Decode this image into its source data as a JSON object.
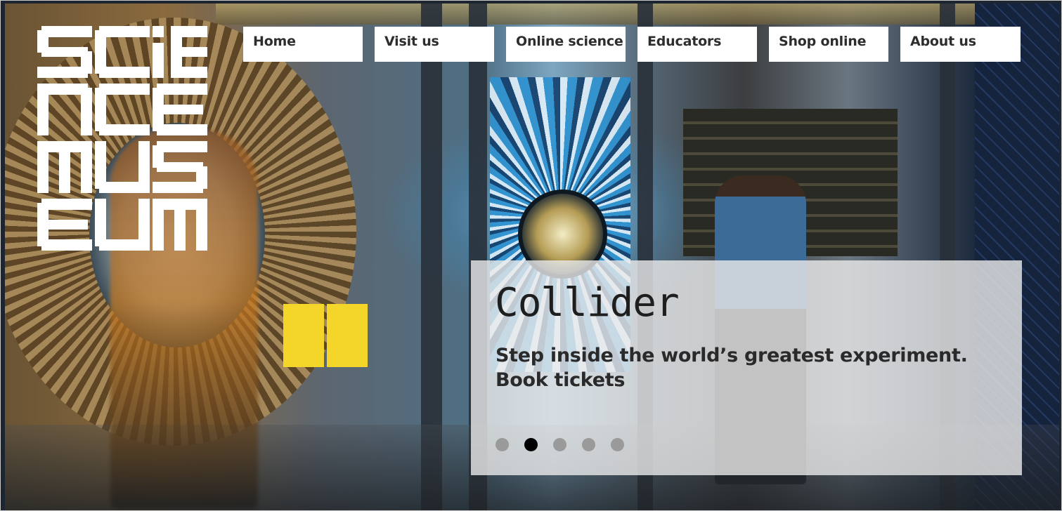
{
  "logo": {
    "text": "SCIENCE MUSEUM",
    "icon": "science-museum-logo"
  },
  "nav": {
    "items": [
      {
        "label": "Home"
      },
      {
        "label": "Visit us"
      },
      {
        "label": "Online science"
      },
      {
        "label": "Educators"
      },
      {
        "label": "Shop online"
      },
      {
        "label": "About us"
      }
    ]
  },
  "promo": {
    "title": "Collider",
    "subtitle": "Step inside the world’s greatest experiment.",
    "cta": "Book tickets",
    "slide_count": 5,
    "active_slide": 2
  },
  "colors": {
    "nav_background": "#ffffff",
    "nav_text": "#2d2d2d",
    "panel_overlay": "#ebebeb",
    "dot_active": "#000000",
    "dot_inactive": "#9a9a9a"
  }
}
